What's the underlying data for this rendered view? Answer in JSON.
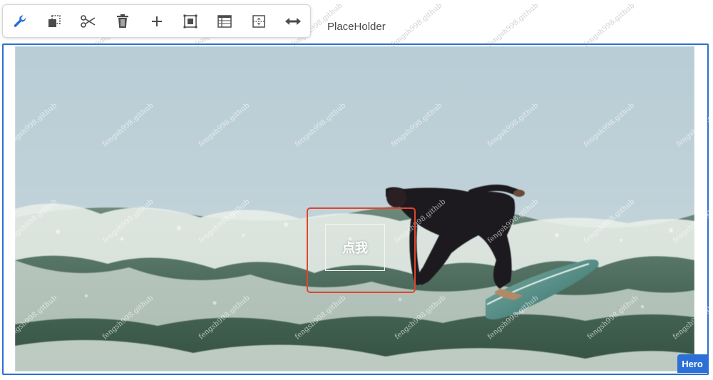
{
  "toolbar": {
    "buttons": [
      {
        "name": "configure-button",
        "icon": "wrench-icon"
      },
      {
        "name": "copy-button",
        "icon": "copy-icon"
      },
      {
        "name": "cut-button",
        "icon": "scissors-icon"
      },
      {
        "name": "delete-button",
        "icon": "trash-icon"
      },
      {
        "name": "insert-button",
        "icon": "plus-icon"
      },
      {
        "name": "group-button",
        "icon": "group-icon"
      },
      {
        "name": "layout-button",
        "icon": "table-layout-icon"
      },
      {
        "name": "parent-button",
        "icon": "select-parent-icon"
      },
      {
        "name": "width-button",
        "icon": "resize-horizontal-icon"
      }
    ]
  },
  "component": {
    "placeholder_label": "PlaceHolder",
    "type_badge": "Hero",
    "cta_label": "点我",
    "image_alt_icon": "surfer-photo"
  },
  "watermark": {
    "text": "fengsh998.github"
  },
  "colors": {
    "frame_border": "#2d6fd1",
    "badge_bg": "#2c6fd6",
    "highlight_border": "#e0452d",
    "icon_color": "#4b4b4b",
    "wrench_color": "#2c6fd6"
  }
}
